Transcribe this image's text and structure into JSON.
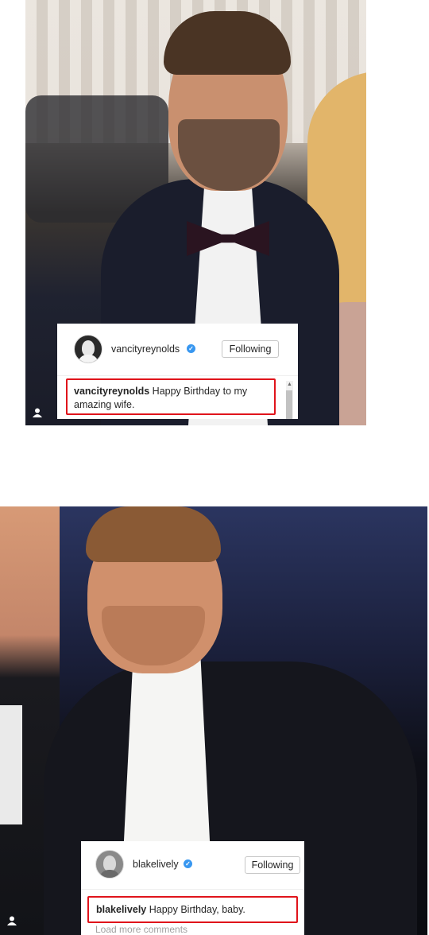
{
  "posts": [
    {
      "username": "vancityreynolds",
      "follow_label": "Following",
      "comment_user": "vancityreynolds",
      "comment_text": "Happy Birthday to my amazing wife."
    },
    {
      "username": "blakelively",
      "follow_label": "Following",
      "comment_user": "blakelively",
      "comment_text": "Happy Birthday, baby.",
      "more_comments": "Load more comments"
    }
  ],
  "icons": {
    "verified": "verified-badge-icon",
    "user": "user-tag-icon",
    "scroll_up": "scroll-up-arrow-icon"
  },
  "colors": {
    "highlight_border": "#e0141b",
    "verified_blue": "#3897f0"
  }
}
